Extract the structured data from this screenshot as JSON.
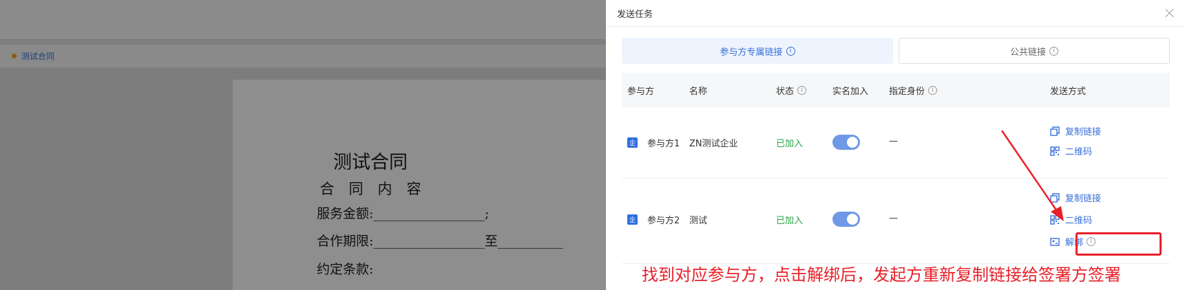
{
  "background": {
    "tab_label": "测试合同",
    "doc": {
      "title": "测试合同",
      "subtitle": "合　同　内　容",
      "line1": "服务金额:_________________;",
      "line2": "合作期限:_________________至__________",
      "line3": "约定条款:"
    }
  },
  "drawer": {
    "title": "发送任务",
    "tabs": [
      {
        "label": "参与方专属链接",
        "active": true
      },
      {
        "label": "公共链接",
        "active": false
      }
    ],
    "columns": {
      "participant": "参与方",
      "name": "名称",
      "status": "状态",
      "real_name": "实名加入",
      "identity": "指定身份",
      "send_method": "发送方式"
    },
    "rows": [
      {
        "badge": "企",
        "participant": "参与方1",
        "name": "ZN测试企业",
        "status": "已加入",
        "real_name_on": true,
        "identity": "—",
        "actions": [
          "复制链接",
          "二维码"
        ]
      },
      {
        "badge": "企",
        "participant": "参与方2",
        "name": "测试",
        "status": "已加入",
        "real_name_on": true,
        "identity": "—",
        "actions": [
          "复制链接",
          "二维码",
          "解绑"
        ]
      }
    ]
  },
  "annotation": {
    "instruction": "找到对应参与方，点击解绑后，发起方重新复制链接给签署方签署",
    "color": "#e8202a"
  },
  "colors": {
    "accent": "#3a6fd8",
    "success": "#28a745",
    "toggle": "#6f98e6"
  }
}
